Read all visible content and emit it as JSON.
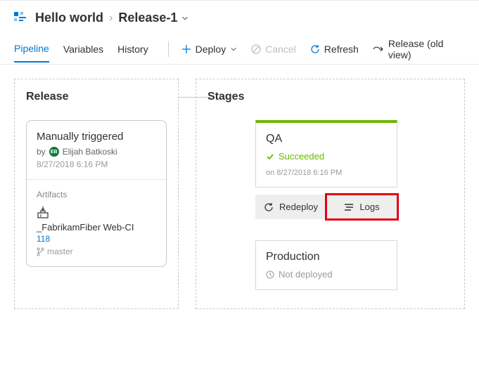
{
  "breadcrumb": {
    "pipeline": "Hello world",
    "release": "Release-1"
  },
  "tabs": {
    "pipeline": "Pipeline",
    "variables": "Variables",
    "history": "History"
  },
  "toolbar": {
    "deploy": "Deploy",
    "cancel": "Cancel",
    "refresh": "Refresh",
    "old_view": "Release (old view)"
  },
  "release_panel": {
    "title": "Release",
    "trigger": "Manually triggered",
    "by_prefix": "by",
    "user": "Elijah Batkoski",
    "timestamp": "8/27/2018 6:16 PM",
    "artifacts_label": "Artifacts",
    "artifact_name": "_FabrikamFiber Web-CI",
    "artifact_build": "118",
    "artifact_branch": "master"
  },
  "stages_panel": {
    "title": "Stages",
    "qa": {
      "name": "QA",
      "status": "Succeeded",
      "timestamp": "on 8/27/2018 6:16 PM",
      "redeploy": "Redeploy",
      "logs": "Logs"
    },
    "prod": {
      "name": "Production",
      "status": "Not deployed"
    }
  }
}
